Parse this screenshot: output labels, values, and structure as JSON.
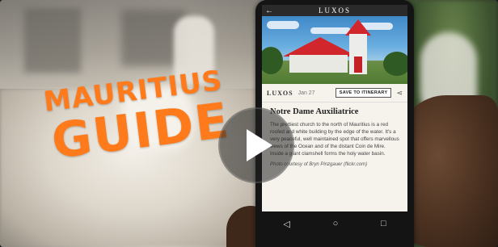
{
  "title": {
    "line1": "MAURITIUS",
    "line2": "GUIDE"
  },
  "phone": {
    "top_bar": {
      "brand": "LUXOS",
      "back_icon": "arrow-left-icon"
    },
    "place_bar": {
      "brand": "LUXOS",
      "date": "Jan 27",
      "save_label": "SAVE TO ITINERARY",
      "share_icon": "share-icon"
    },
    "place": {
      "title": "Notre Dame Auxiliatrice",
      "description": "The prettiest church to the north of Mauritius is a red roofed and white building by the edge of the water. It's a very peaceful, well maintained spot that offers marvellous views of the Ocean and of the distant Coin de Mire. Inside a giant clamshell forms the holy water basin.",
      "credit": "Photo courtesy of Bryn Pinzgauer (flickr.com)"
    },
    "nav": {
      "back": "◁",
      "home": "○",
      "recent": "□"
    }
  },
  "video": {
    "play_icon": "play-icon"
  }
}
